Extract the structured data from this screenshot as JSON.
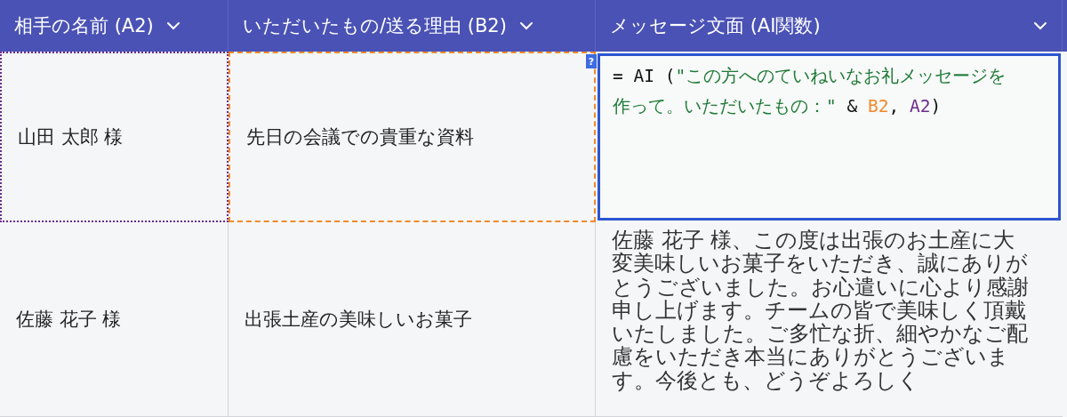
{
  "columns": [
    {
      "label": "相手の名前 (A2)"
    },
    {
      "label": "いただいたもの/送る理由 (B2)"
    },
    {
      "label": "メッセージ文面 (AI関数)"
    }
  ],
  "rows": [
    {
      "cells": [
        {
          "kind": "text",
          "text": "山田 太郎 様",
          "color": "#6b2d8f"
        },
        {
          "kind": "text",
          "text": "先日の会議での貴重な資料",
          "color": "#f0892a"
        },
        {
          "kind": "formula",
          "help": "?",
          "tokens": [
            {
              "text": "= AI (",
              "color": "#111111"
            },
            {
              "text": "\"この方へのていねいなお礼メッセージを作って。いただいたもの：\"",
              "color": "#1e7a36"
            },
            {
              "text": " & ",
              "color": "#111111"
            },
            {
              "text": "B2",
              "color": "#f0892a"
            },
            {
              "text": ", ",
              "color": "#111111"
            },
            {
              "text": "A2",
              "color": "#6b2d8f"
            },
            {
              "text": ")",
              "color": "#111111"
            }
          ]
        }
      ]
    },
    {
      "cells": [
        {
          "kind": "text",
          "text": "佐藤 花子 様"
        },
        {
          "kind": "text",
          "text": "出張土産の美味しいお菓子"
        },
        {
          "kind": "message",
          "text": "佐藤 花子 様、この度は出張のお土産に大変美味しいお菓子をいただき、誠にありがとうございました。お心遣いに心より感謝申し上げます。チームの皆で美味しく頂戴いたしました。ご多忙な折、細やかなご配慮をいただき本当にありがとうございます。今後とも、どうぞよろしく"
        }
      ]
    }
  ]
}
